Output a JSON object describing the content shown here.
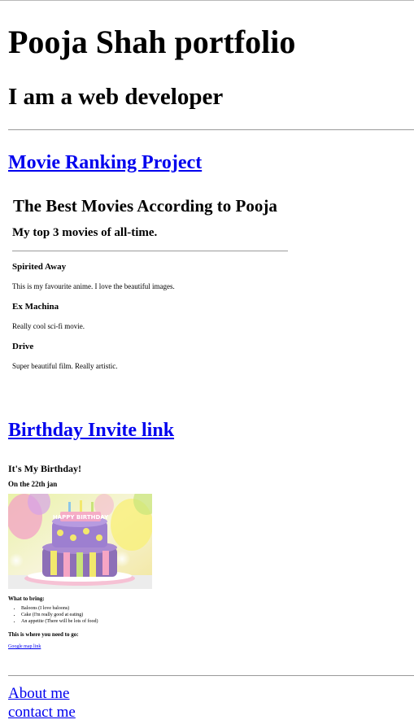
{
  "header": {
    "title": "Pooja Shah portfolio",
    "subtitle": "I am a web developer"
  },
  "projects": {
    "movie_link": "Movie Ranking Project",
    "movie_page": {
      "title": "The Best Movies According to Pooja",
      "subtitle": "My top 3 movies of all-time.",
      "movies": [
        {
          "title": "Spirited Away",
          "desc": "This is my favourite anime. I love the beautiful images."
        },
        {
          "title": "Ex Machina",
          "desc": "Really cool sci-fi movie."
        },
        {
          "title": "Drive",
          "desc": "Super beautiful film. Really artistic."
        }
      ]
    },
    "birthday_link": "Birthday Invite link",
    "birthday_page": {
      "title": "It's My Birthday!",
      "date": "On the 22th jan",
      "cake_topper": "HAPPY BIRTHDAY",
      "bring_heading": "What to bring:",
      "bring_items": [
        "Baloons (I love baloons)",
        "Cake (I'm really good at eating)",
        "An appetite (There will be lots of food)"
      ],
      "where_heading": "This is where you need to go:",
      "map_link": "Google map link"
    }
  },
  "footer": {
    "about": "About me",
    "contact": "contact me"
  },
  "colors": {
    "link": "#0000ee",
    "rule": "#9a9a9a"
  }
}
